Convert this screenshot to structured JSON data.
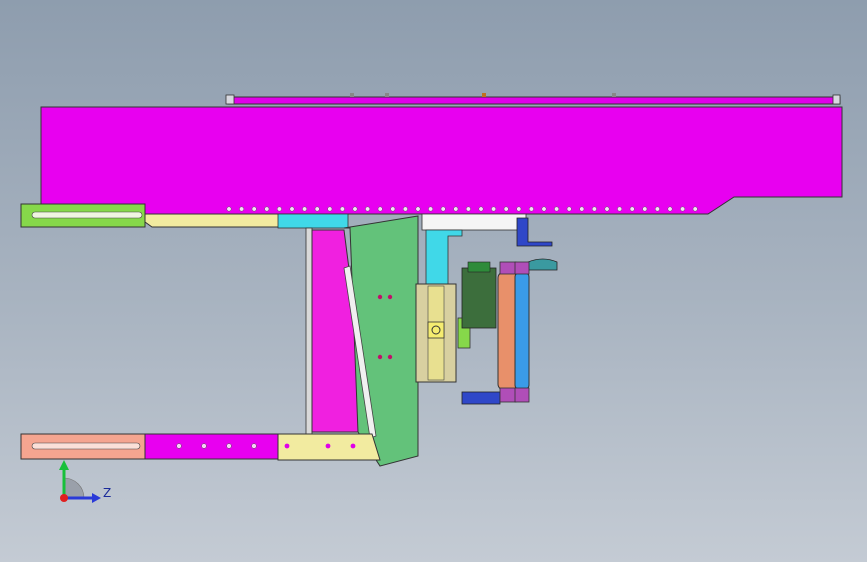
{
  "triad": {
    "z_label": "Z"
  },
  "colors": {
    "magenta_beam": "#e800f0",
    "pink_panel": "#f020e0",
    "green_plate": "#63c27a",
    "yellow_rail": "#f2eba0",
    "lime_rail": "#86d84a",
    "salmon_rail": "#f5a590",
    "cyan_block": "#40d8e8",
    "roller_orange": "#e8906a",
    "roller_blue": "#3a9be8",
    "motor_green": "#3c6e3c"
  }
}
